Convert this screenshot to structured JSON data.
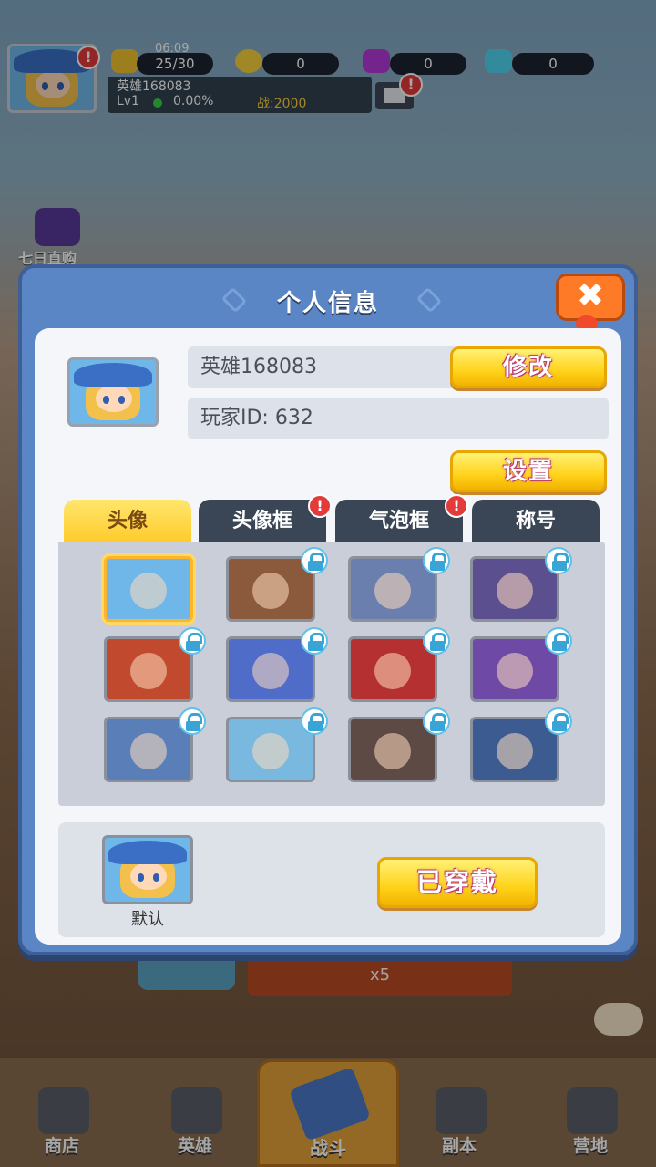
{
  "status_bar": {
    "time": "06:09",
    "stamina": "25/30",
    "gold": "0",
    "gems_purple": "0",
    "diamonds": "0",
    "player_name": "英雄168083",
    "level": "Lv1",
    "exp_percent": "0.00%",
    "power": "战:2000"
  },
  "side": {
    "seven_day_label": "七日直购"
  },
  "modal": {
    "title": "个人信息",
    "close_glyph": "✖",
    "name_value": "英雄168083",
    "id_value": "玩家ID:  632",
    "modify_label": "修改",
    "settings_label": "设置",
    "tabs": [
      {
        "label": "头像",
        "active": true,
        "badge": false
      },
      {
        "label": "头像框",
        "active": false,
        "badge": true
      },
      {
        "label": "气泡框",
        "active": false,
        "badge": true
      },
      {
        "label": "称号",
        "active": false,
        "badge": false
      }
    ],
    "avatars": [
      {
        "name": "blonde-mage",
        "locked": false,
        "selected": true,
        "color": "#6fb7e8"
      },
      {
        "name": "minotaur",
        "locked": true,
        "color": "#8b5a3c"
      },
      {
        "name": "armored-golem",
        "locked": true,
        "color": "#6b7fae"
      },
      {
        "name": "dark-elf",
        "locked": true,
        "color": "#5c4f8f"
      },
      {
        "name": "fire-priestess",
        "locked": true,
        "color": "#c0492e"
      },
      {
        "name": "blue-dragon",
        "locked": true,
        "color": "#4f6cc9"
      },
      {
        "name": "red-demon",
        "locked": true,
        "color": "#b53030"
      },
      {
        "name": "purple-knight",
        "locked": true,
        "color": "#6e4aa6"
      },
      {
        "name": "old-wizard",
        "locked": true,
        "color": "#5a7fb8"
      },
      {
        "name": "blonde-mage-alt",
        "locked": true,
        "color": "#79b9e0"
      },
      {
        "name": "horned-sage",
        "locked": true,
        "color": "#5d4a45"
      },
      {
        "name": "pirate-captain",
        "locked": true,
        "color": "#3b5b91"
      }
    ],
    "default_label": "默认",
    "equipped_label": "已穿戴"
  },
  "background": {
    "banner_text": "x5"
  },
  "nav": [
    {
      "label": "商店",
      "icon": "shop-icon"
    },
    {
      "label": "英雄",
      "icon": "hero-helmet-icon"
    },
    {
      "label": "战斗",
      "icon": "crossed-swords-icon"
    },
    {
      "label": "副本",
      "icon": "dungeon-icon"
    },
    {
      "label": "营地",
      "icon": "camp-icon"
    }
  ],
  "colors": {
    "modal_blue": "#5b86c6",
    "accent_yellow": "#ffd31a",
    "close_orange": "#ff7a26",
    "badge_red": "#e33a3a"
  }
}
